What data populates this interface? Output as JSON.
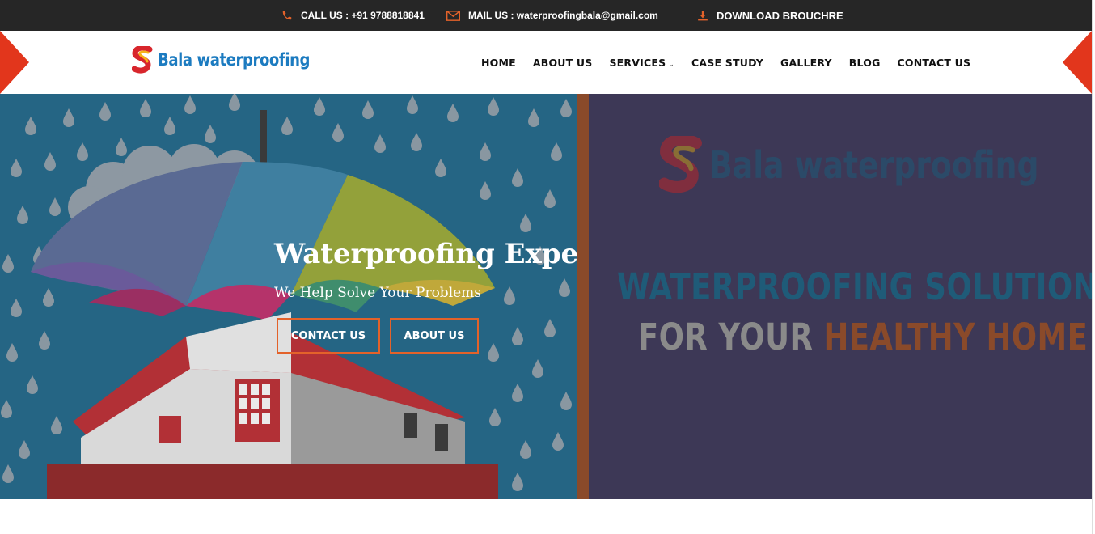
{
  "topbar": {
    "call_label": "CALL US : +91 9788818841",
    "mail_label": "MAIL US : waterproofingbala@gmail.com",
    "download_label": "DOWNLOAD BROUCHRE"
  },
  "brand": {
    "name": "Bala waterproofing",
    "logo_icon": "bala-s-logo-icon"
  },
  "nav": {
    "items": [
      {
        "label": "HOME"
      },
      {
        "label": "ABOUT US"
      },
      {
        "label": "SERVICES"
      },
      {
        "label": "CASE STUDY"
      },
      {
        "label": "GALLERY"
      },
      {
        "label": "BLOG"
      },
      {
        "label": "CONTACT US"
      }
    ]
  },
  "hero": {
    "title": "Waterproofing Expert",
    "subtitle": "We Help Solve Your Problems",
    "contact_button": "CONTACT US",
    "about_button": "ABOUT US",
    "banner_brand": "Bala waterproofing",
    "banner_line1": "WATERPROOFING SOLUTIONS",
    "banner_line2_a": "FOR YOUR ",
    "banner_line2_b": "HEALTHY HOME"
  },
  "colors": {
    "accent": "#e3622a",
    "topbar_bg": "#262626",
    "brand_blue": "#1c7bc0",
    "hero_blue": "#256584",
    "hero_purple": "#3d3856"
  }
}
